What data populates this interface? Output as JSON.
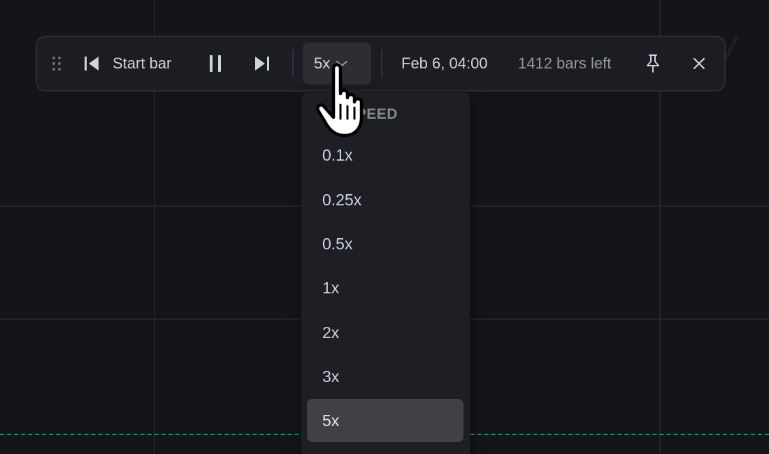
{
  "colors": {
    "background": "#141519",
    "toolbar_bg": "#1c1d22",
    "text_primary": "#d1d4dc",
    "text_secondary": "#9598a1",
    "selected_bg": "#404147",
    "price_line": "#1f8f7a"
  },
  "toolbar": {
    "drag_handle_icon": "drag-dots-icon",
    "start_bar_icon": "skip-to-start-icon",
    "start_bar_label": "Start bar",
    "pause_icon": "pause-icon",
    "step_forward_icon": "step-forward-icon",
    "speed_value": "5x",
    "speed_chevron_icon": "chevron-down-icon",
    "date_text": "Feb 6, 04:00",
    "bars_left_text": "1412 bars left",
    "pin_icon": "pin-icon",
    "close_icon": "close-icon"
  },
  "speed_menu": {
    "header_visible": "AY SPEED",
    "items": [
      "0.1x",
      "0.25x",
      "0.5x",
      "1x",
      "2x",
      "3x",
      "5x"
    ],
    "selected": "5x"
  },
  "cursor": {
    "icon": "hand-pointer-icon"
  }
}
